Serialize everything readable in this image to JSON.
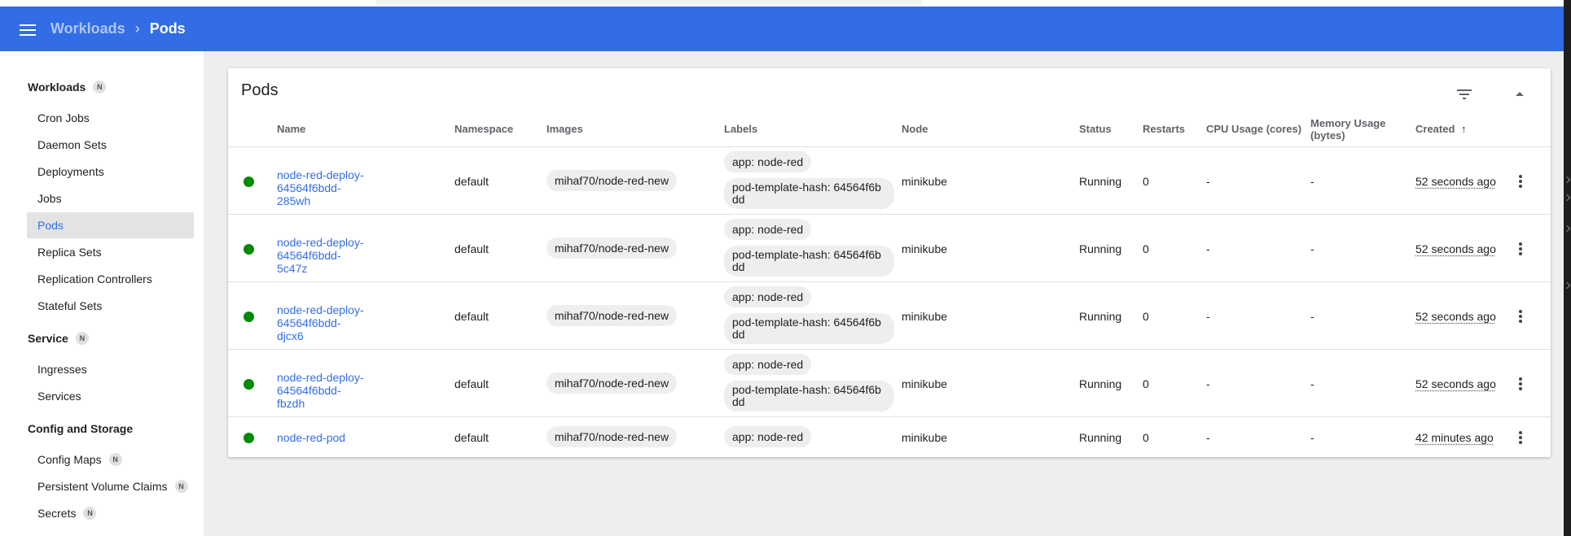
{
  "breadcrumb": {
    "parent": "Workloads",
    "current": "Pods"
  },
  "sidebar": {
    "badge": "N",
    "sections": [
      {
        "label": "Workloads",
        "badge": "N",
        "items": [
          "Cron Jobs",
          "Daemon Sets",
          "Deployments",
          "Jobs",
          "Pods",
          "Replica Sets",
          "Replication Controllers",
          "Stateful Sets"
        ],
        "active": "Pods"
      },
      {
        "label": "Service",
        "badge": "N",
        "items": [
          "Ingresses",
          "Services"
        ]
      },
      {
        "label": "Config and Storage",
        "items": [
          "Config Maps",
          "Persistent Volume Claims",
          "Secrets"
        ],
        "item_badges": {
          "Config Maps": "N",
          "Persistent Volume Claims": "N",
          "Secrets": "N"
        }
      }
    ]
  },
  "card": {
    "title": "Pods",
    "filter_icon": "filter-list-icon",
    "collapse_icon": "expand-less-icon",
    "columns": [
      "Name",
      "Namespace",
      "Images",
      "Labels",
      "Node",
      "Status",
      "Restarts",
      "CPU Usage (cores)",
      "Memory Usage (bytes)",
      "Created"
    ],
    "sort_indicator": "↑",
    "rows": [
      {
        "name_line1": "node-red-deploy-64564f6bdd-",
        "name_line2": "285wh",
        "namespace": "default",
        "image": "mihaf70/node-red-new",
        "label1": "app: node-red",
        "label2_line1": "pod-template-hash: 64564f6b",
        "label2_line2": "dd",
        "node": "minikube",
        "status": "Running",
        "restarts": "0",
        "cpu": "-",
        "memory": "-",
        "created": "52 seconds ago"
      },
      {
        "name_line1": "node-red-deploy-64564f6bdd-",
        "name_line2": "5c47z",
        "namespace": "default",
        "image": "mihaf70/node-red-new",
        "label1": "app: node-red",
        "label2_line1": "pod-template-hash: 64564f6b",
        "label2_line2": "dd",
        "node": "minikube",
        "status": "Running",
        "restarts": "0",
        "cpu": "-",
        "memory": "-",
        "created": "52 seconds ago"
      },
      {
        "name_line1": "node-red-deploy-64564f6bdd-",
        "name_line2": "djcx6",
        "namespace": "default",
        "image": "mihaf70/node-red-new",
        "label1": "app: node-red",
        "label2_line1": "pod-template-hash: 64564f6b",
        "label2_line2": "dd",
        "node": "minikube",
        "status": "Running",
        "restarts": "0",
        "cpu": "-",
        "memory": "-",
        "created": "52 seconds ago"
      },
      {
        "name_line1": "node-red-deploy-64564f6bdd-",
        "name_line2": "fbzdh",
        "namespace": "default",
        "image": "mihaf70/node-red-new",
        "label1": "app: node-red",
        "label2_line1": "pod-template-hash: 64564f6b",
        "label2_line2": "dd",
        "node": "minikube",
        "status": "Running",
        "restarts": "0",
        "cpu": "-",
        "memory": "-",
        "created": "52 seconds ago"
      },
      {
        "name_line1": "node-red-pod",
        "namespace": "default",
        "image": "mihaf70/node-red-new",
        "label1": "app: node-red",
        "node": "minikube",
        "status": "Running",
        "restarts": "0",
        "cpu": "-",
        "memory": "-",
        "created": "42 minutes ago"
      }
    ]
  },
  "colors": {
    "appbar": "#326de6",
    "running": "#008a00",
    "link": "#326de6"
  }
}
